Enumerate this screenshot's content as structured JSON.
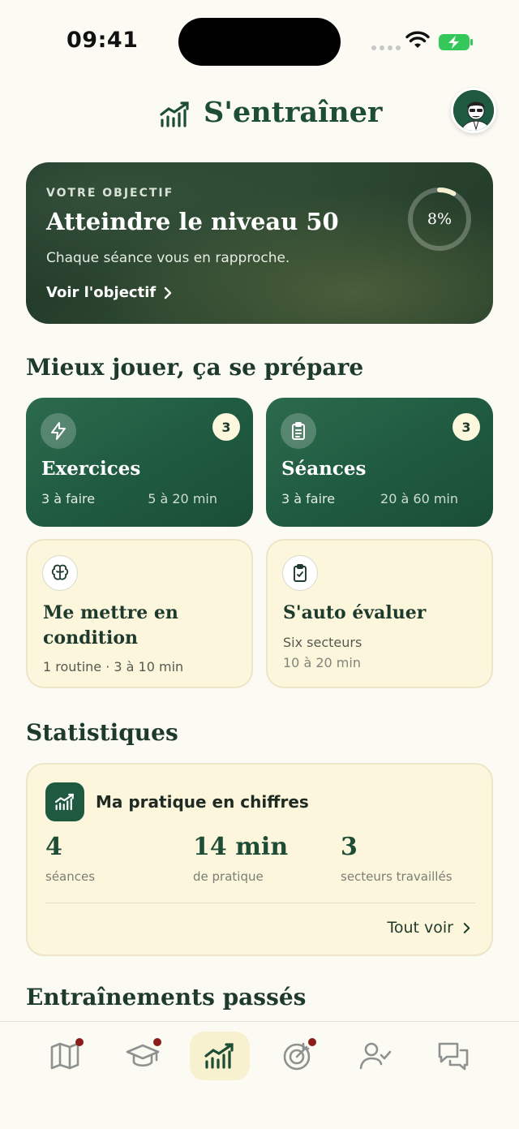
{
  "status": {
    "time": "09:41"
  },
  "header": {
    "title": "S'entraîner"
  },
  "goal": {
    "kicker": "VOTRE OBJECTIF",
    "title": "Atteindre le niveau 50",
    "subtitle": "Chaque séance vous en rapproche.",
    "link": "Voir l'objectif",
    "progress_label": "8%",
    "progress_value": 0.08
  },
  "prepare": {
    "title": "Mieux jouer, ça se prépare",
    "cards": [
      {
        "title": "Exercices",
        "count": "3",
        "left": "3 à faire",
        "right": "5 à 20 min",
        "icon": "lightning-icon"
      },
      {
        "title": "Séances",
        "count": "3",
        "left": "3 à faire",
        "right": "20 à 60 min",
        "icon": "clipboard-list-icon"
      },
      {
        "title": "Me mettre en condition",
        "line1": "1 routine · 3 à 10 min",
        "icon": "brain-icon"
      },
      {
        "title": "S'auto évaluer",
        "line1": "Six secteurs",
        "line2": "10 à 20 min",
        "icon": "clipboard-check-icon"
      }
    ]
  },
  "stats": {
    "section_title": "Statistiques",
    "card_title": "Ma pratique en chiffres",
    "items": [
      {
        "value": "4",
        "label": "séances"
      },
      {
        "value": "14 min",
        "label": "de pratique"
      },
      {
        "value": "3",
        "label": "secteurs travaillés"
      }
    ],
    "see_all": "Tout voir"
  },
  "past": {
    "title": "Entraînements passés"
  },
  "nav": {
    "items": [
      {
        "icon": "map-icon",
        "badge": true
      },
      {
        "icon": "graduation-cap-icon",
        "badge": true
      },
      {
        "icon": "chart-icon",
        "active": true
      },
      {
        "icon": "target-icon",
        "badge": true
      },
      {
        "icon": "user-check-icon"
      },
      {
        "icon": "chat-icon"
      }
    ]
  },
  "colors": {
    "primary": "#1f5a40",
    "cream": "#fcf6dc",
    "badge": "#8a1f1a",
    "background": "#fcfbf3"
  }
}
